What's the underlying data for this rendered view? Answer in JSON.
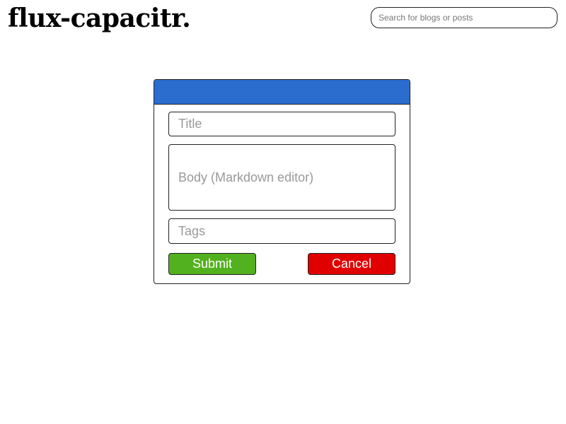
{
  "header": {
    "logo": "flux-capacitr.",
    "search_placeholder": "Search for blogs or posts"
  },
  "modal": {
    "header_color": "#2b6ccf",
    "title_placeholder": "Title",
    "body_placeholder": "Body (Markdown editor)",
    "tags_placeholder": "Tags",
    "submit_label": "Submit",
    "submit_color": "#52b11e",
    "cancel_label": "Cancel",
    "cancel_color": "#e00000"
  }
}
